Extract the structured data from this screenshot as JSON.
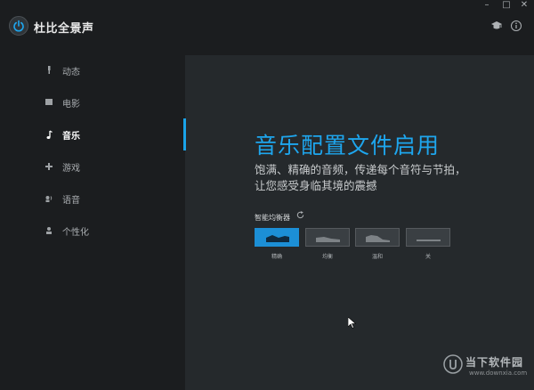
{
  "app": {
    "title": "杜比全景声"
  },
  "window_controls": {
    "minimize": "–",
    "maximize": "□",
    "close": "✕"
  },
  "header_icons": [
    "graduation-cap-icon",
    "info-icon"
  ],
  "sidebar": {
    "items": [
      {
        "label": "动态",
        "icon": "dynamic-icon",
        "active": false
      },
      {
        "label": "电影",
        "icon": "movie-icon",
        "active": false
      },
      {
        "label": "音乐",
        "icon": "music-note-icon",
        "active": true
      },
      {
        "label": "游戏",
        "icon": "gamepad-icon",
        "active": false
      },
      {
        "label": "语音",
        "icon": "voice-icon",
        "active": false
      },
      {
        "label": "个性化",
        "icon": "person-icon",
        "active": false
      }
    ]
  },
  "main": {
    "headline": "音乐配置文件启用",
    "description": "饱满、精确的音频，传递每个音符与节拍，让您感受身临其境的震撼",
    "equalizer": {
      "label": "智能均衡器",
      "presets": [
        {
          "label": "精确",
          "active": true
        },
        {
          "label": "均衡",
          "active": false
        },
        {
          "label": "温和",
          "active": false
        },
        {
          "label": "关",
          "active": false
        }
      ]
    }
  },
  "watermark": {
    "name": "当下软件园",
    "url": "www.downxia.com"
  },
  "colors": {
    "accent": "#1ea6ee",
    "sidebar_bg": "#1b1d1f",
    "main_bg": "#25292c"
  }
}
